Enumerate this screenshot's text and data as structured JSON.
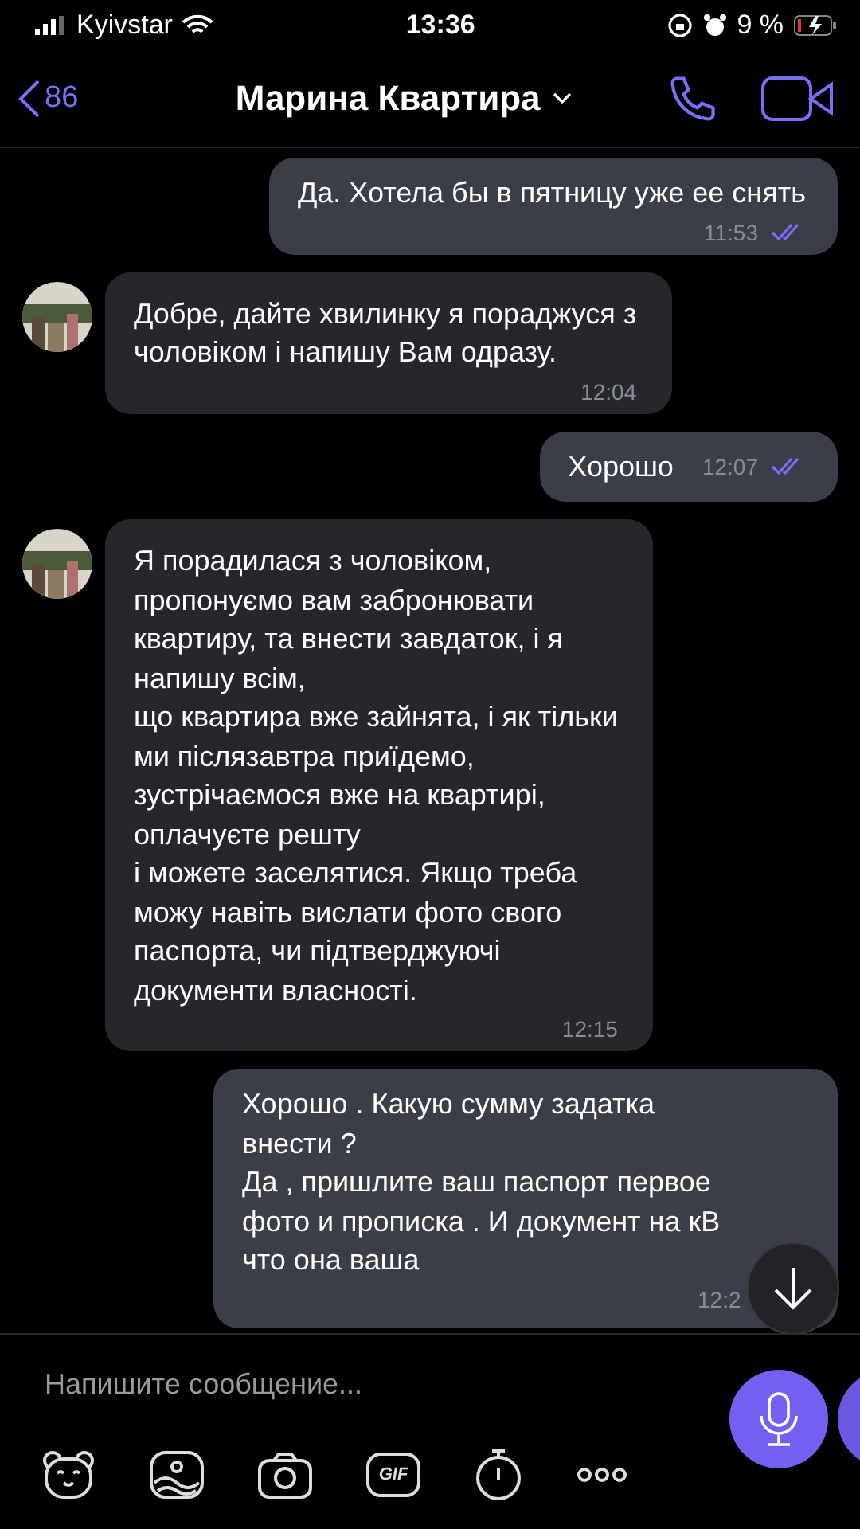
{
  "status_bar": {
    "carrier": "Kyivstar",
    "time": "13:36",
    "battery": "9 %"
  },
  "header": {
    "back_count": "86",
    "title": "Марина Квартира"
  },
  "messages": [
    {
      "kind": "out",
      "text": "Да. Хотела бы в пятницу уже ее снять",
      "time": "11:53",
      "read": true
    },
    {
      "kind": "in",
      "text": "Добре, дайте хвилинку я пораджуся з\nчоловіком і напишу Вам одразу.",
      "time": "12:04"
    },
    {
      "kind": "out",
      "text": "Хорошо",
      "time": "12:07",
      "read": true
    },
    {
      "kind": "in",
      "text": "Я порадилася з чоловіком,\nпропонуємо вам забронювати\nквартиру, та внести завдаток, і я\nнапишу всім,\nщо квартира вже зайнята, і як тільки\nми післязавтра приїдемо,\nзустрічаємося вже на квартирі,\nоплачуєте решту\nі можете заселятися. Якщо треба\nможу навіть вислати фото свого\nпаспорта, чи підтверджуючі\nдокументи власності.",
      "time": "12:15"
    },
    {
      "kind": "out",
      "text": "Хорошо . Какую сумму задатка\nвнести ?\nДа , пришлите ваш паспорт первое\nфото и прописка . И документ на кВ\nчто она ваша",
      "time": "12:2"
    }
  ],
  "composer": {
    "placeholder": "Напишите сообщение...",
    "gif_label": "GIF"
  }
}
